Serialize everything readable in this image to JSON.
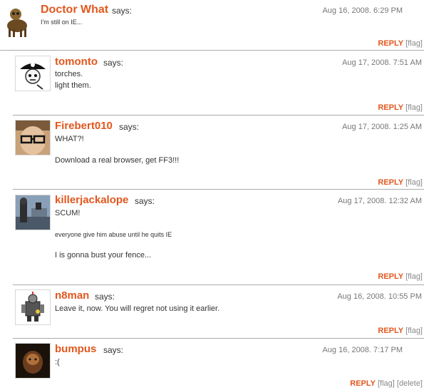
{
  "comments": [
    {
      "author": "Doctor What",
      "says": "says:",
      "date": "Aug 16, 2008. 6:29 PM",
      "lines": [
        "I'm still on IE..."
      ],
      "reply": "REPLY",
      "flag": "[flag]"
    },
    {
      "author": "tomonto",
      "says": "says:",
      "date": "Aug 17, 2008. 7:51 AM",
      "lines": [
        "torches.",
        "light them."
      ],
      "reply": "REPLY",
      "flag": "[flag]"
    },
    {
      "author": "Firebert010",
      "says": "says:",
      "date": "Aug 17, 2008. 1:25 AM",
      "lines": [
        "WHAT?!",
        "Download a real browser, get FF3!!!"
      ],
      "reply": "REPLY",
      "flag": "[flag]"
    },
    {
      "author": "killerjackalope",
      "says": "says:",
      "date": "Aug 17, 2008. 12:32 AM",
      "lines": [
        "SCUM!",
        "everyone give him abuse until he quits IE",
        "I is gonna bust your fence..."
      ],
      "reply": "REPLY",
      "flag": "[flag]"
    },
    {
      "author": "n8man",
      "says": "says:",
      "date": "Aug 16, 2008. 10:55 PM",
      "lines": [
        "Leave it, now. You will regret not using it earlier."
      ],
      "reply": "REPLY",
      "flag": "[flag]"
    },
    {
      "author": "bumpus",
      "says": "says:",
      "date": "Aug 16, 2008. 7:17 PM",
      "lines": [
        ":("
      ],
      "reply": "REPLY",
      "flag": "[flag]",
      "delete": "[delete]"
    }
  ],
  "colors": {
    "author_link": "#e2571e",
    "reply_link": "#e2571e",
    "divider": "#aaaaaa"
  }
}
